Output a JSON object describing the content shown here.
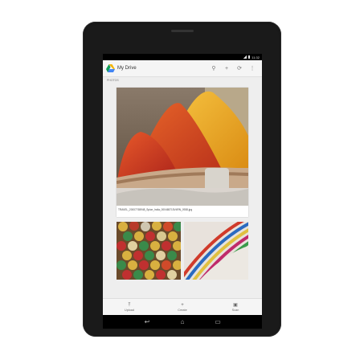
{
  "status_bar": {
    "time": "11:32"
  },
  "action_bar": {
    "title": "My Drive",
    "icons": [
      "search-icon",
      "add-icon",
      "refresh-icon",
      "overflow-menu-icon"
    ],
    "glyphs": {
      "search": "⚲",
      "add": "+",
      "refresh": "⟳",
      "overflow": "⋮"
    }
  },
  "breadcrumb": "PHOTOS",
  "main_photo": {
    "caption": "TRAVEL_20007765948_Spice_India_000465715V4RN_0938.jpg"
  },
  "bottom_bar": {
    "items": [
      {
        "label": "Upload",
        "glyph": "⤒",
        "icon": "upload-icon"
      },
      {
        "label": "Create",
        "glyph": "+",
        "icon": "create-icon"
      },
      {
        "label": "Scan",
        "glyph": "▣",
        "icon": "camera-icon"
      }
    ]
  },
  "nav_bar": {
    "back": "↩",
    "home": "⌂",
    "recents": "▭"
  },
  "colors": {
    "bezel": "#1a1a1a",
    "screen_bg": "#eeeeee",
    "drive_green": "#0f9d58",
    "drive_yellow": "#f4b400",
    "drive_blue": "#4285f4"
  }
}
